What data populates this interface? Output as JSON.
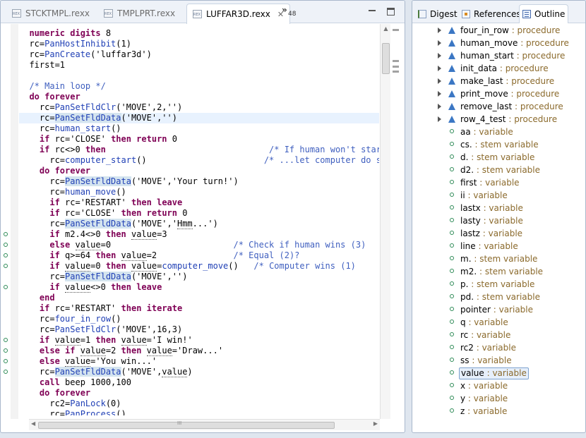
{
  "editor": {
    "tabs": [
      {
        "label": "STCKTMPL.rexx",
        "active": false
      },
      {
        "label": "TMPLPRT.rexx",
        "active": false
      },
      {
        "label": "LUFFAR3D.rexx",
        "active": true
      }
    ],
    "close_glyph": "✕",
    "overflow_glyph": "»",
    "overflow_count": "48",
    "hscroll_grip": "III",
    "lines": [
      {
        "html": "  <span class=\"kw\">numeric digits</span> 8"
      },
      {
        "html": "  rc=<span class=\"fn\">PanHostInhibit</span>(1)"
      },
      {
        "html": "  rc=<span class=\"fn\">PanCreate</span>('luffar3d')"
      },
      {
        "html": "  first=1"
      },
      {
        "html": ""
      },
      {
        "html": "  <span class=\"cmt\">/* Main loop */</span>"
      },
      {
        "html": "  <span class=\"kw\">do forever</span>"
      },
      {
        "html": "    rc=<span class=\"fn\">PanSetFldClr</span>('MOVE',2,'')"
      },
      {
        "html": "    rc=<span class=\"fn hl\">PanSetFldData</span>('MOVE','')",
        "current": true
      },
      {
        "html": "    rc=<span class=\"fn\">human_start</span>()"
      },
      {
        "html": "    <span class=\"kw\">if</span> rc='CLOSE' <span class=\"kw\">then return</span> 0"
      },
      {
        "html": "    <span class=\"kw\">if</span> rc&lt;&gt;0 <span class=\"kw\">then</span>                                <span class=\"cmt\">/* If human won't start...</span>"
      },
      {
        "html": "      rc=<span class=\"fn\">computer_start</span>()                       <span class=\"cmt\">/* ...let computer do so</span>"
      },
      {
        "html": "    <span class=\"kw\">do forever</span>"
      },
      {
        "html": "      rc=<span class=\"fn hl\">PanSetFldData</span>('MOVE','Your turn!')"
      },
      {
        "html": "      rc=<span class=\"fn\">human_move</span>()"
      },
      {
        "html": "      <span class=\"kw\">if</span> rc='RESTART' <span class=\"kw\">then leave</span>"
      },
      {
        "html": "      <span class=\"kw\">if</span> rc='CLOSE' <span class=\"kw\">then return</span> 0"
      },
      {
        "html": "      rc=<span class=\"fn hl\">PanSetFldData</span>('MOVE','<span class=\"ul\">Hmm</span>...')"
      },
      {
        "html": "      <span class=\"kw\">if</span> m2.4&lt;&gt;0 <span class=\"kw\">then</span> <span class=\"ul\">value</span>=3",
        "mark": true
      },
      {
        "html": "      <span class=\"kw\">else</span> <span class=\"ul\">value</span>=0                        <span class=\"cmt\">/* Check if human wins (3)</span>",
        "mark": true
      },
      {
        "html": "      <span class=\"kw\">if</span> q&gt;=64 <span class=\"kw\">then</span> <span class=\"ul\">value</span>=2               <span class=\"cmt\">/* Equal (2)?</span>",
        "mark": true
      },
      {
        "html": "      <span class=\"kw\">if</span> <span class=\"ul\">value</span>=0 <span class=\"kw\">then</span> <span class=\"ul\">value</span>=<span class=\"fn\">computer_move</span>()   <span class=\"cmt\">/* Computer wins (1)</span>",
        "mark": true
      },
      {
        "html": "      rc=<span class=\"fn hl\">PanSetFldData</span>('MOVE','')"
      },
      {
        "html": "      <span class=\"kw\">if</span> <span class=\"ul\">value</span>&lt;&gt;0 <span class=\"kw\">then leave</span>",
        "mark": true
      },
      {
        "html": "    <span class=\"kw\">end</span>"
      },
      {
        "html": "    <span class=\"kw\">if</span> rc='RESTART' <span class=\"kw\">then iterate</span>"
      },
      {
        "html": "    rc=<span class=\"fn\">four_in_row</span>()"
      },
      {
        "html": "    rc=<span class=\"fn\">PanSetFldClr</span>('MOVE',16,3)"
      },
      {
        "html": "    <span class=\"kw\">if</span> <span class=\"ul\">value</span>=1 <span class=\"kw\">then</span> <span class=\"ul\">value</span>='I win!'",
        "mark": true
      },
      {
        "html": "    <span class=\"kw\">else if</span> <span class=\"ul\">value</span>=2 <span class=\"kw\">then</span> <span class=\"ul\">value</span>='Draw...'",
        "mark": true
      },
      {
        "html": "    <span class=\"kw\">else</span> <span class=\"ul\">value</span>='You win...'",
        "mark": true
      },
      {
        "html": "    rc=<span class=\"fn hl\">PanSetFldData</span>('MOVE',<span class=\"ul\">value</span>)",
        "mark": true
      },
      {
        "html": "    <span class=\"kw\">call</span> beep 1000,100"
      },
      {
        "html": "    <span class=\"kw\">do forever</span>"
      },
      {
        "html": "      rc2=<span class=\"fn\">PanLock</span>(0)"
      },
      {
        "html": "      rc=<span class=\"fn\">PanProcess</span>()"
      }
    ]
  },
  "outline_panel": {
    "tabs": [
      {
        "label": "Digest",
        "icon": "digest-icon",
        "active": false
      },
      {
        "label": "References",
        "icon": "references-icon",
        "active": false
      },
      {
        "label": "Outline",
        "icon": "outline-icon",
        "active": true
      }
    ],
    "items": [
      {
        "name": "four_in_row",
        "kind": "procedure"
      },
      {
        "name": "human_move",
        "kind": "procedure"
      },
      {
        "name": "human_start",
        "kind": "procedure"
      },
      {
        "name": "init_data",
        "kind": "procedure"
      },
      {
        "name": "make_last",
        "kind": "procedure"
      },
      {
        "name": "print_move",
        "kind": "procedure"
      },
      {
        "name": "remove_last",
        "kind": "procedure"
      },
      {
        "name": "row_4_test",
        "kind": "procedure"
      },
      {
        "name": "aa",
        "kind": "variable"
      },
      {
        "name": "cs.",
        "kind": "stem variable"
      },
      {
        "name": "d.",
        "kind": "stem variable"
      },
      {
        "name": "d2.",
        "kind": "stem variable"
      },
      {
        "name": "first",
        "kind": "variable"
      },
      {
        "name": "ii",
        "kind": "variable"
      },
      {
        "name": "lastx",
        "kind": "variable"
      },
      {
        "name": "lasty",
        "kind": "variable"
      },
      {
        "name": "lastz",
        "kind": "variable"
      },
      {
        "name": "line",
        "kind": "variable"
      },
      {
        "name": "m.",
        "kind": "stem variable"
      },
      {
        "name": "m2.",
        "kind": "stem variable"
      },
      {
        "name": "p.",
        "kind": "stem variable"
      },
      {
        "name": "pd.",
        "kind": "stem variable"
      },
      {
        "name": "pointer",
        "kind": "variable"
      },
      {
        "name": "q",
        "kind": "variable"
      },
      {
        "name": "rc",
        "kind": "variable"
      },
      {
        "name": "rc2",
        "kind": "variable"
      },
      {
        "name": "ss",
        "kind": "variable"
      },
      {
        "name": "value",
        "kind": "variable",
        "selected": true
      },
      {
        "name": "x",
        "kind": "variable"
      },
      {
        "name": "y",
        "kind": "variable"
      },
      {
        "name": "z",
        "kind": "variable"
      }
    ]
  }
}
